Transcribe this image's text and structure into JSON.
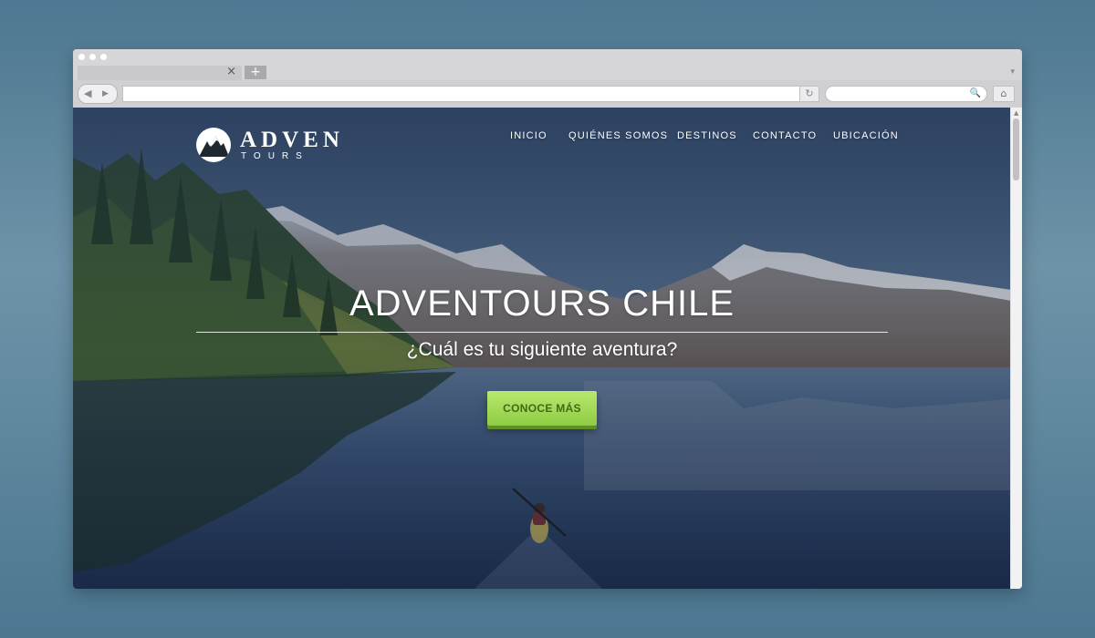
{
  "browser": {
    "tab_close_glyph": "×",
    "new_tab_glyph": "+",
    "back_glyph": "◀",
    "forward_glyph": "▶",
    "reload_glyph": "↻",
    "search_glyph": "🔍",
    "home_glyph": "⌂",
    "tab_menu_glyph": "▾",
    "url_value": "",
    "search_value": ""
  },
  "site": {
    "logo": {
      "title": "ADVEN",
      "subtitle": "TOURS"
    },
    "nav": [
      {
        "label": "INICIO"
      },
      {
        "label": "QUIÉNES SOMOS"
      },
      {
        "label": "DESTINOS"
      },
      {
        "label": "CONTACTO"
      },
      {
        "label": "UBICACIÓN"
      }
    ],
    "hero": {
      "title": "ADVENTOURS CHILE",
      "subtitle": "¿Cuál es tu siguiente aventura?",
      "cta_label": "CONOCE MÁS"
    }
  },
  "colors": {
    "background": "#5c87a0",
    "cta": "#9fd556",
    "overlay": "#243a5c"
  }
}
